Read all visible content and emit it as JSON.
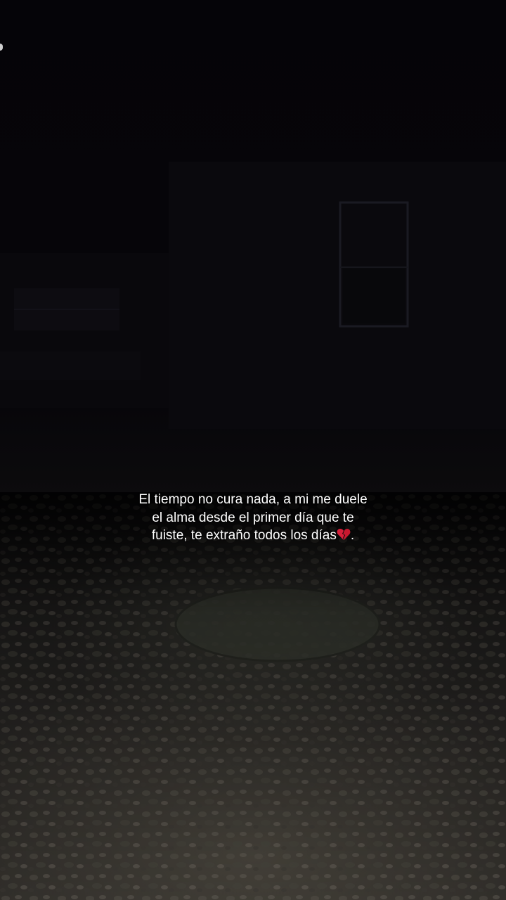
{
  "caption": {
    "text": "El tiempo no cura nada, a mi me duele el alma desde el primer día que te fuiste, te extraño todos los días",
    "suffix": ".",
    "emoji_icon": "broken-heart-icon"
  },
  "colors": {
    "sky": "#050408",
    "ground": "#34312d",
    "caption_text": "#ffffff",
    "heart": "#d81f3a"
  }
}
